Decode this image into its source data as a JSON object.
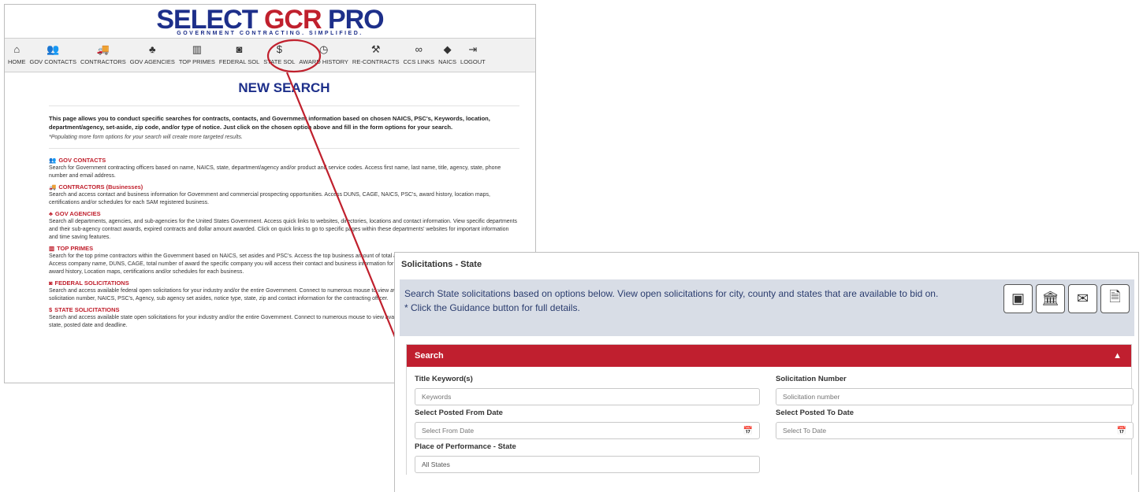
{
  "back": {
    "logo": {
      "part1": "SELECT",
      "part2": "GCR",
      "part3": "PRO",
      "tagline": "GOVERNMENT CONTRACTING. SIMPLIFIED."
    },
    "nav": [
      {
        "label": "HOME",
        "icon": "home-icon",
        "glyph": "⌂"
      },
      {
        "label": "GOV CONTACTS",
        "icon": "users-icon",
        "glyph": "👥"
      },
      {
        "label": "CONTRACTORS",
        "icon": "truck-icon",
        "glyph": "🚚"
      },
      {
        "label": "GOV AGENCIES",
        "icon": "sitemap-icon",
        "glyph": "♣"
      },
      {
        "label": "TOP PRIMES",
        "icon": "building-icon",
        "glyph": "▥"
      },
      {
        "label": "FEDERAL SOL",
        "icon": "money-icon",
        "glyph": "◙"
      },
      {
        "label": "STATE SOL",
        "icon": "dollar-icon",
        "glyph": "$"
      },
      {
        "label": "AWARD HISTORY",
        "icon": "clock-icon",
        "glyph": "◷"
      },
      {
        "label": "RE-CONTRACTS",
        "icon": "gavel-icon",
        "glyph": "⚒"
      },
      {
        "label": "CCS LINKS",
        "icon": "link-icon",
        "glyph": "∞"
      },
      {
        "label": "NAICS",
        "icon": "tags-icon",
        "glyph": "◆"
      },
      {
        "label": "LOGOUT",
        "icon": "logout-icon",
        "glyph": "⇥"
      }
    ],
    "title": "NEW SEARCH",
    "intro": "This page allows you to conduct specific searches for contracts, contacts, and Government information based on chosen NAICS, PSC's, Keywords, location, department/agency, set-aside, zip code, and/or type of notice. Just click on the chosen option above and fill in the form options for your search.",
    "intro_note": "*Populating more form options for your search will create more targeted results.",
    "sections": [
      {
        "title": "GOV CONTACTS",
        "icon": "users-icon",
        "glyph": "👥",
        "desc": "Search for Government contracting officers based on name, NAICS, state, department/agency and/or product and service codes. Access first name, last name, title, agency, state, phone number and email address."
      },
      {
        "title": "CONTRACTORS (Businesses)",
        "icon": "truck-icon",
        "glyph": "🚚",
        "desc": "Search and access contact and business information for Government and commercial prospecting opportunities. Access DUNS, CAGE, NAICS, PSC's, award history, location maps, certifications and/or schedules for each SAM registered business."
      },
      {
        "title": "GOV AGENCIES",
        "icon": "sitemap-icon",
        "glyph": "♣",
        "desc": "Search all departments, agencies, and sub-agencies for the United States Government. Access quick links to websites, directories, locations and contact information. View specific departments and their sub-agency contract awards, expired contracts and dollar amount awarded. Click on quick links to go to specific pages within these departments' websites for important information and time saving features."
      },
      {
        "title": "TOP PRIMES",
        "icon": "building-icon",
        "glyph": "▥",
        "desc": "Search for the top prime contractors within the Government based on NAICS, set asides and PSC's. Access the top business amount of total awarded contracts for their specific industry. Access company name, DUNS, CAGE, total number of award the specific company you will access their contact and business information for Government and commercial prospecting PSC's, award history, Location maps, certifications and/or schedules for each business."
      },
      {
        "title": "FEDERAL SOLICITATIONS",
        "icon": "money-icon",
        "glyph": "◙",
        "desc": "Search and access available federal open solicitations for your industry and/or the entire Government. Connect to numerous mouse to view available contracts to bid on. View the contract title, solicitation number, NAICS, PSC's, Agency, sub agency set asides, notice type, state, zip and contact information for the contracting officer."
      },
      {
        "title": "STATE SOLICITATIONS",
        "icon": "dollar-icon",
        "glyph": "$",
        "desc": "Search and access available state open solicitations for your industry and/or the entire Government. Connect to numerous mouse to view available contracts to bid on. View the contract id, title, state, posted date and deadline."
      }
    ]
  },
  "front": {
    "title": "Solicitations - State",
    "banner_text": "Search State solicitations based on options below. View open solicitations for city, county and states that are available to bid on.",
    "banner_note": "* Click the Guidance button for full details.",
    "banner_buttons": [
      {
        "icon": "contact-card-icon",
        "glyph": "▣"
      },
      {
        "icon": "bank-icon",
        "glyph": "🏛"
      },
      {
        "icon": "mail-truck-icon",
        "glyph": "✉"
      },
      {
        "icon": "document-icon",
        "glyph": "🗎"
      }
    ],
    "search": {
      "header": "Search",
      "toggle_glyph": "▲",
      "fields": {
        "title_keywords": {
          "label": "Title Keyword(s)",
          "placeholder": "Keywords"
        },
        "solicitation_number": {
          "label": "Solicitation Number",
          "placeholder": "Solicitation number"
        },
        "posted_from": {
          "label": "Select Posted From Date",
          "placeholder": "Select From Date"
        },
        "posted_to": {
          "label": "Select Posted To Date",
          "placeholder": "Select To Date"
        },
        "state": {
          "label": "Place of Performance - State",
          "value": "All States"
        }
      },
      "calendar_glyph": "📅"
    }
  },
  "colors": {
    "brand_blue": "#1d2f8a",
    "brand_red": "#c0202d",
    "search_header": "#c01f2f",
    "banner_bg": "#d8dde6"
  }
}
